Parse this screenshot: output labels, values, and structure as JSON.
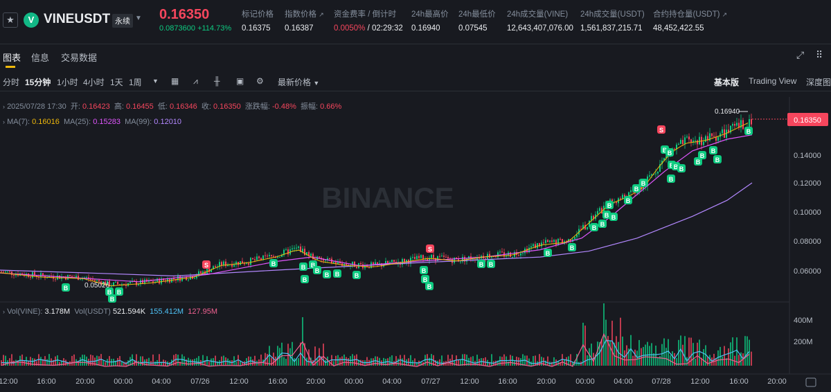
{
  "header": {
    "symbol": "VINEUSDT",
    "contract_type": "永续",
    "last_price": "0.16350",
    "change_abs": "0.0873600",
    "change_pct": "+114.73%",
    "stats": [
      {
        "label": "标记价格",
        "value": "0.16375"
      },
      {
        "label": "指数价格",
        "value": "0.16387"
      },
      {
        "label": "资金费率 / 倒计时",
        "value_funding": "0.0050%",
        "value_countdown": " / 02:29:32"
      },
      {
        "label": "24h最高价",
        "value": "0.16940"
      },
      {
        "label": "24h最低价",
        "value": "0.07545"
      },
      {
        "label": "24h成交量(VINE)",
        "value": "12,643,407,076.00"
      },
      {
        "label": "24h成交量(USDT)",
        "value": "1,561,837,215.71"
      },
      {
        "label": "合约持仓量(USDT)",
        "value": "48,452,422.55"
      }
    ]
  },
  "tabs": [
    {
      "label": "图表",
      "active": true
    },
    {
      "label": "信息",
      "active": false
    },
    {
      "label": "交易数据",
      "active": false
    }
  ],
  "toolbar": {
    "intervals": [
      "分时",
      "15分钟",
      "1小时",
      "4小时",
      "1天",
      "1周"
    ],
    "active_interval": "15分钟",
    "price_type": "最新价格",
    "views": [
      "基本版",
      "Trading View",
      "深度图"
    ],
    "active_view": "基本版"
  },
  "legend": {
    "datetime": "2025/07/28 17:30",
    "open_label": "开:",
    "open": "0.16423",
    "high_label": "高:",
    "high": "0.16455",
    "low_label": "低:",
    "low": "0.16346",
    "close_label": "收:",
    "close": "0.16350",
    "change_label": "涨跌幅:",
    "change": "-0.48%",
    "amplitude_label": "振幅:",
    "amplitude": "0.66%",
    "ma7_label": "MA(7):",
    "ma7": "0.16016",
    "ma25_label": "MA(25):",
    "ma25": "0.15283",
    "ma99_label": "MA(99):",
    "ma99": "0.12010"
  },
  "vol_legend": {
    "vine_label": "Vol(VINE):",
    "vine": "3.178M",
    "usdt_label": "Vol(USDT)",
    "usdt": "521.594K",
    "ma1": "155.412M",
    "ma2": "127.95M"
  },
  "watermark": "BINANCE",
  "colors": {
    "up": "#0ecb81",
    "down": "#f6465d",
    "ma7": "#f0b90b",
    "ma25": "#e056fd",
    "ma99": "#b388ff",
    "accent": "#f0b90b"
  },
  "chart_data": {
    "type": "candlestick",
    "y_ticks": [
      "0.14000",
      "0.12000",
      "0.10000",
      "0.08000",
      "0.06000"
    ],
    "y_range": [
      0.04,
      0.17
    ],
    "current_price_tag": "0.16350",
    "high_marker": "0.16940",
    "low_marker": "0.05026",
    "x_ticks": [
      "12:00",
      "16:00",
      "20:00",
      "00:00",
      "04:00",
      "07/26",
      "12:00",
      "16:00",
      "20:00",
      "00:00",
      "04:00",
      "07/27",
      "12:00",
      "16:00",
      "20:00",
      "00:00",
      "04:00",
      "07/28",
      "12:00",
      "16:00",
      "20:00"
    ],
    "vol_ticks": [
      "400M",
      "200M"
    ],
    "close_path": [
      [
        0,
        0.059
      ],
      [
        60,
        0.056
      ],
      [
        120,
        0.055
      ],
      [
        160,
        0.05
      ],
      [
        220,
        0.052
      ],
      [
        280,
        0.056
      ],
      [
        320,
        0.064
      ],
      [
        360,
        0.066
      ],
      [
        400,
        0.07
      ],
      [
        430,
        0.075
      ],
      [
        460,
        0.067
      ],
      [
        500,
        0.064
      ],
      [
        540,
        0.063
      ],
      [
        580,
        0.066
      ],
      [
        620,
        0.069
      ],
      [
        660,
        0.067
      ],
      [
        700,
        0.07
      ],
      [
        740,
        0.071
      ],
      [
        780,
        0.078
      ],
      [
        820,
        0.08
      ],
      [
        850,
        0.093
      ],
      [
        880,
        0.106
      ],
      [
        910,
        0.112
      ],
      [
        930,
        0.118
      ],
      [
        950,
        0.131
      ],
      [
        970,
        0.142
      ],
      [
        990,
        0.148
      ],
      [
        1020,
        0.15
      ],
      [
        1050,
        0.155
      ],
      [
        1080,
        0.162
      ],
      [
        1086,
        0.1635
      ]
    ],
    "ma25_path": [
      [
        0,
        0.058
      ],
      [
        100,
        0.055
      ],
      [
        200,
        0.052
      ],
      [
        300,
        0.057
      ],
      [
        400,
        0.066
      ],
      [
        450,
        0.069
      ],
      [
        520,
        0.063
      ],
      [
        600,
        0.066
      ],
      [
        700,
        0.069
      ],
      [
        780,
        0.074
      ],
      [
        840,
        0.082
      ],
      [
        880,
        0.096
      ],
      [
        920,
        0.112
      ],
      [
        960,
        0.128
      ],
      [
        1000,
        0.142
      ],
      [
        1050,
        0.15
      ],
      [
        1086,
        0.153
      ]
    ],
    "ma99_path": [
      [
        0,
        0.06
      ],
      [
        130,
        0.058
      ],
      [
        250,
        0.056
      ],
      [
        400,
        0.06
      ],
      [
        600,
        0.065
      ],
      [
        780,
        0.069
      ],
      [
        850,
        0.073
      ],
      [
        920,
        0.082
      ],
      [
        1000,
        0.097
      ],
      [
        1050,
        0.108
      ],
      [
        1086,
        0.12
      ]
    ],
    "buy_markers": [
      [
        95,
        415
      ],
      [
        158,
        421
      ],
      [
        172,
        421
      ],
      [
        162,
        431
      ],
      [
        395,
        380
      ],
      [
        438,
        385
      ],
      [
        452,
        382
      ],
      [
        440,
        403
      ],
      [
        458,
        390
      ],
      [
        472,
        396
      ],
      [
        487,
        395
      ],
      [
        515,
        397
      ],
      [
        612,
        390
      ],
      [
        614,
        403
      ],
      [
        620,
        413
      ],
      [
        695,
        381
      ],
      [
        709,
        381
      ],
      [
        791,
        365
      ],
      [
        826,
        357
      ],
      [
        858,
        328
      ],
      [
        870,
        323
      ],
      [
        880,
        296
      ],
      [
        876,
        310
      ],
      [
        886,
        313
      ],
      [
        907,
        289
      ],
      [
        919,
        272
      ],
      [
        929,
        264
      ],
      [
        960,
        216
      ],
      [
        967,
        220
      ],
      [
        970,
        238
      ],
      [
        976,
        240
      ],
      [
        984,
        243
      ],
      [
        969,
        258
      ],
      [
        1008,
        233
      ],
      [
        1014,
        224
      ],
      [
        1030,
        217
      ],
      [
        1036,
        230
      ],
      [
        1081,
        189
      ]
    ],
    "sell_markers": [
      [
        298,
        382
      ],
      [
        621,
        359
      ],
      [
        955,
        187
      ]
    ]
  }
}
